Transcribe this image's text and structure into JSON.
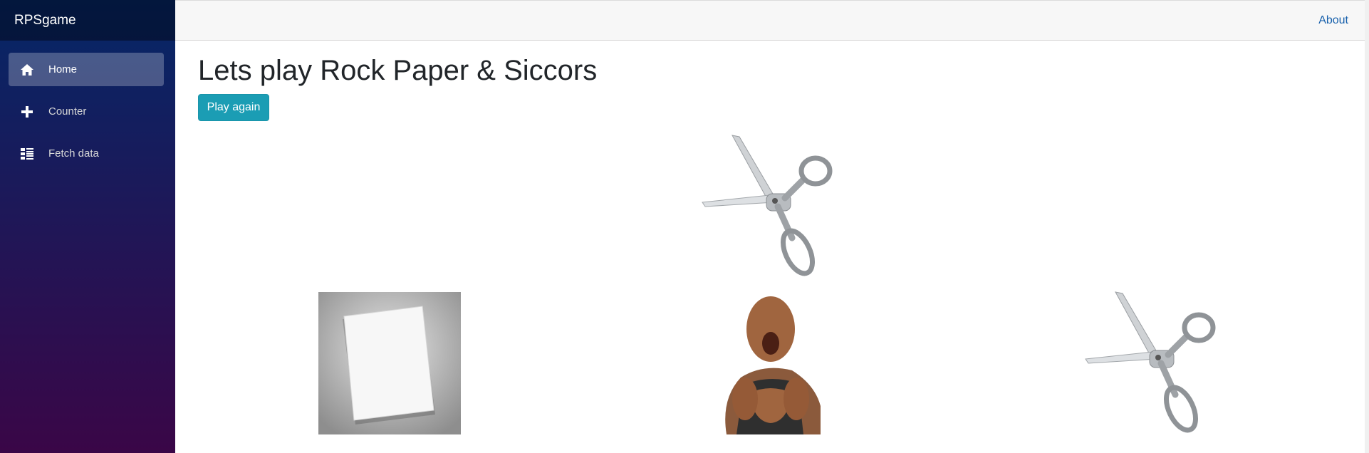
{
  "app": {
    "brand": "RPSgame"
  },
  "sidebar": {
    "items": [
      {
        "label": "Home",
        "icon": "home-icon",
        "active": true
      },
      {
        "label": "Counter",
        "icon": "plus-icon",
        "active": false
      },
      {
        "label": "Fetch data",
        "icon": "list-icon",
        "active": false
      }
    ]
  },
  "topbar": {
    "about_label": "About"
  },
  "main": {
    "title": "Lets play Rock Paper & Siccors",
    "play_again_label": "Play again",
    "computer_choice": "scissors",
    "options": [
      "paper",
      "rock",
      "scissors"
    ]
  },
  "colors": {
    "sidebar_top": "#052767",
    "sidebar_bottom": "#3a0647",
    "button": "#1b9db4",
    "link": "#1861ac"
  }
}
